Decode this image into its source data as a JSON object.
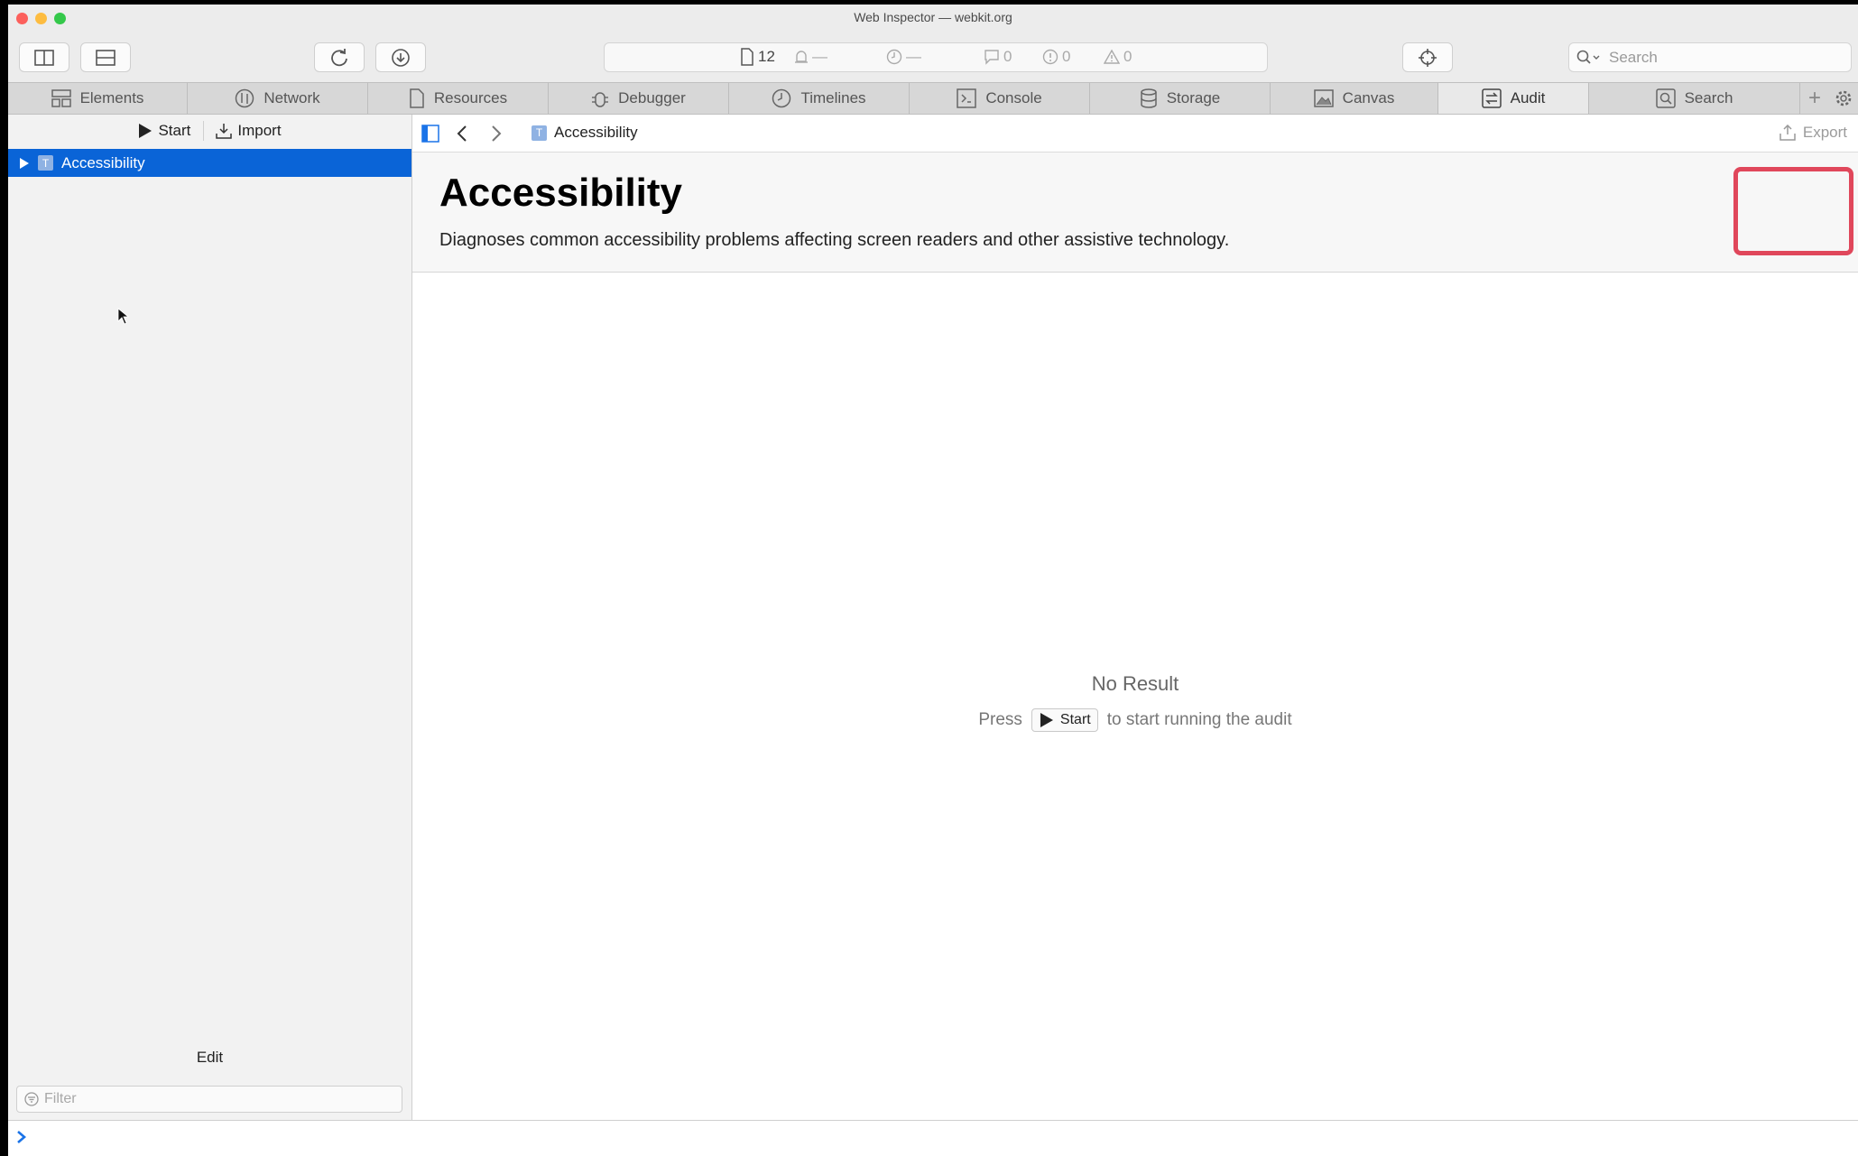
{
  "window": {
    "title": "Web Inspector — webkit.org"
  },
  "toolbar": {
    "activity": {
      "resources_count": "12",
      "bell_value": "—",
      "timer_value": "—",
      "logs_count": "0",
      "errors_count": "0",
      "warnings_count": "0"
    },
    "search_placeholder": "Search"
  },
  "tabs": [
    {
      "label": "Elements",
      "icon": "elements-icon"
    },
    {
      "label": "Network",
      "icon": "network-icon"
    },
    {
      "label": "Resources",
      "icon": "document-icon"
    },
    {
      "label": "Debugger",
      "icon": "bug-icon"
    },
    {
      "label": "Timelines",
      "icon": "clock-icon"
    },
    {
      "label": "Console",
      "icon": "console-icon"
    },
    {
      "label": "Storage",
      "icon": "storage-icon"
    },
    {
      "label": "Canvas",
      "icon": "canvas-icon"
    },
    {
      "label": "Audit",
      "icon": "audit-icon",
      "active": true
    },
    {
      "label": "Search",
      "icon": "search-icon"
    }
  ],
  "sidebar": {
    "start_label": "Start",
    "import_label": "Import",
    "tree_item": {
      "badge": "T",
      "label": "Accessibility"
    },
    "edit_label": "Edit",
    "filter_placeholder": "Filter"
  },
  "main": {
    "breadcrumb": {
      "badge": "T",
      "label": "Accessibility"
    },
    "export_label": "Export",
    "title": "Accessibility",
    "description": "Diagnoses common accessibility problems affecting screen readers and other assistive technology.",
    "empty_title": "No Result",
    "hint_press": "Press",
    "hint_button": "Start",
    "hint_suffix": "to start running the audit"
  },
  "colors": {
    "selection": "#0a64d7",
    "highlight": "#e0475b",
    "prompt": "#1a73e8"
  }
}
